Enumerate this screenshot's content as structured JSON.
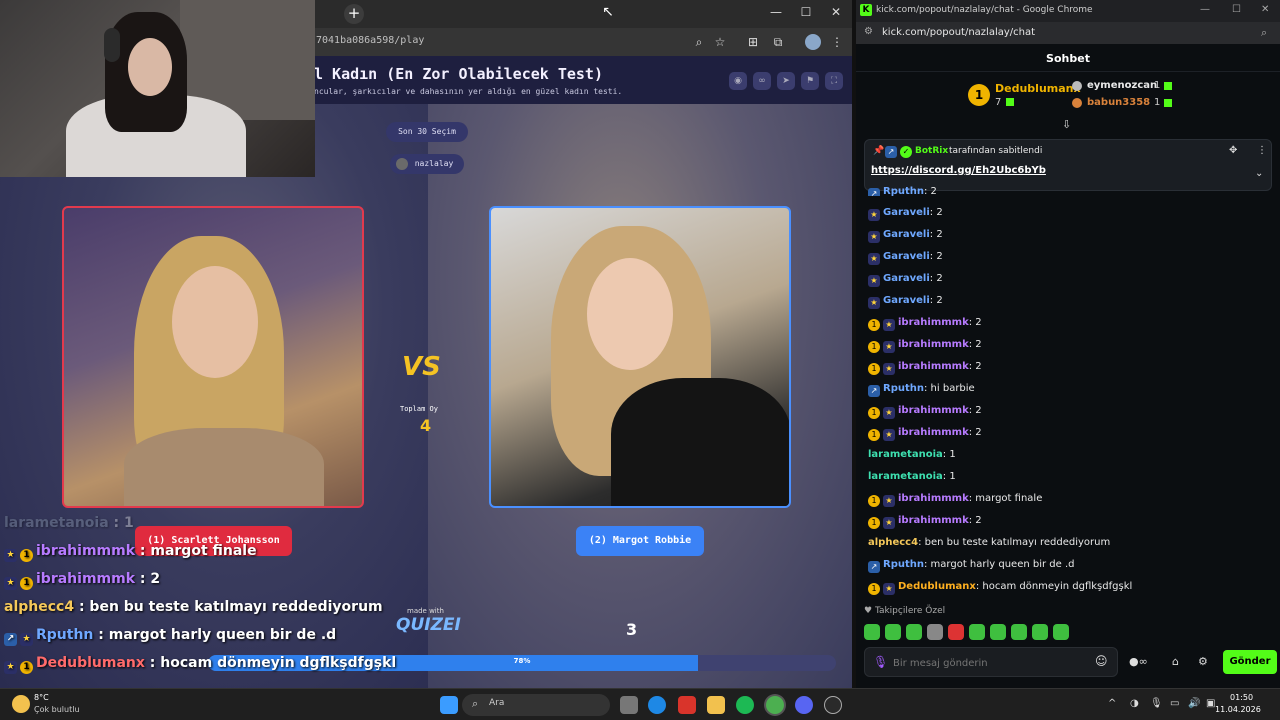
{
  "quiz_browser": {
    "url": "7041ba086a598/play",
    "title": "l Kadın (En Zor Olabilecek Test)",
    "subtitle": "ncular, şarkıcılar ve dahasının yer aldığı en güzel kadın testi.",
    "round_pill": "Son 30 Seçim",
    "creator_pill": "nazlalay",
    "left_choice": "(1) Scarlett Johansson",
    "right_choice": "(2) Margot Robbie",
    "vs_label": "VS",
    "total_votes_label": "Toplam Oy",
    "total_votes": "4",
    "made_with": "made with",
    "brand": "QUIZEI",
    "counter": "3",
    "progress_text": "78%",
    "progress": 0.78
  },
  "overlay_chat": [
    {
      "user": "larametanoia",
      "text": " : 1"
    },
    {
      "user": "ibrahimmmk",
      "text": " : margot finale"
    },
    {
      "user": "ibrahimmmk",
      "text": " : 2"
    },
    {
      "user": "alphecc4",
      "text": " : ben bu teste katılmayı reddediyorum"
    },
    {
      "user": "Rputhn",
      "text": " : margot harly queen bir de .d"
    },
    {
      "user": "Dedublumanx",
      "text": " : hocam dönmeyin dgflkşdfgşkl"
    }
  ],
  "chat_window": {
    "title": "kick.com/popout/nazlalay/chat - Google Chrome",
    "url": "kick.com/popout/nazlalay/chat",
    "header": "Sohbet",
    "leaders": [
      {
        "name": "Dedublumanx",
        "count": "7"
      },
      {
        "name": "eymenozcan",
        "count": "1"
      },
      {
        "name": "babun3358",
        "count": "1"
      }
    ],
    "pinned_by": "BotRix",
    "pinned_suffix": "tarafından sabitlendi",
    "pinned_link": "https://discord.gg/Eh2Ubc6bYb",
    "messages": [
      {
        "user": "Rputhn",
        "text": ": 2",
        "color": "#6fa8ff",
        "badges": [
          "vip"
        ]
      },
      {
        "user": "Garaveli",
        "text": ": 2",
        "color": "#6fa8ff",
        "badges": [
          "sub"
        ]
      },
      {
        "user": "Garaveli",
        "text": ": 2",
        "color": "#6fa8ff",
        "badges": [
          "sub"
        ]
      },
      {
        "user": "Garaveli",
        "text": ": 2",
        "color": "#6fa8ff",
        "badges": [
          "sub"
        ]
      },
      {
        "user": "Garaveli",
        "text": ": 2",
        "color": "#6fa8ff",
        "badges": [
          "sub"
        ]
      },
      {
        "user": "Garaveli",
        "text": ": 2",
        "color": "#6fa8ff",
        "badges": [
          "sub"
        ]
      },
      {
        "user": "ibrahimmmk",
        "text": ": 2",
        "color": "#b77bff",
        "badges": [
          "coin",
          "sub"
        ]
      },
      {
        "user": "ibrahimmmk",
        "text": ": 2",
        "color": "#b77bff",
        "badges": [
          "coin",
          "sub"
        ]
      },
      {
        "user": "ibrahimmmk",
        "text": ": 2",
        "color": "#b77bff",
        "badges": [
          "coin",
          "sub"
        ]
      },
      {
        "user": "Rputhn",
        "text": ": hi barbie",
        "color": "#6fa8ff",
        "badges": [
          "vip"
        ]
      },
      {
        "user": "ibrahimmmk",
        "text": ": 2",
        "color": "#b77bff",
        "badges": [
          "coin",
          "sub"
        ]
      },
      {
        "user": "ibrahimmmk",
        "text": ": 2",
        "color": "#b77bff",
        "badges": [
          "coin",
          "sub"
        ]
      },
      {
        "user": "larametanoia",
        "text": ": 1",
        "color": "#3ee0b0",
        "badges": []
      },
      {
        "user": "larametanoia",
        "text": ": 1",
        "color": "#3ee0b0",
        "badges": []
      },
      {
        "user": "ibrahimmmk",
        "text": ": margot finale",
        "color": "#b77bff",
        "badges": [
          "coin",
          "sub"
        ]
      },
      {
        "user": "ibrahimmmk",
        "text": ": 2",
        "color": "#b77bff",
        "badges": [
          "coin",
          "sub"
        ]
      },
      {
        "user": "alphecc4",
        "text": ": ben bu teste katılmayı reddediyorum",
        "color": "#f5c85a",
        "badges": []
      },
      {
        "user": "Rputhn",
        "text": ": margot harly queen bir de .d",
        "color": "#6fa8ff",
        "badges": [
          "vip"
        ]
      },
      {
        "user": "Dedublumanx",
        "text": ": hocam dönmeyin dgflkşdfgşkl",
        "color": "#ffb020",
        "badges": [
          "coin",
          "sub"
        ]
      }
    ],
    "followers_label": "Takipçilere Özel",
    "input_placeholder": "Bir mesaj gönderin",
    "send_label": "Gönder"
  },
  "taskbar": {
    "temperature": "8°C",
    "weather": "Çok bulutlu",
    "search_label": "Ara",
    "time": "01:50",
    "date": "11.04.2026"
  }
}
